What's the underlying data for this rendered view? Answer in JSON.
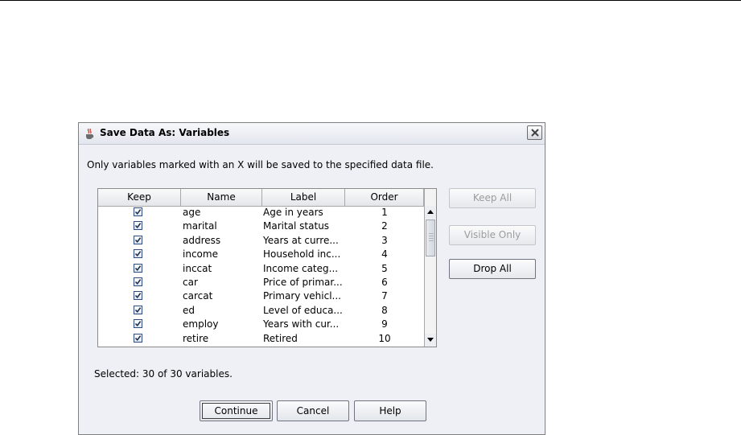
{
  "dialog": {
    "title": "Save Data As: Variables",
    "instruction": "Only variables marked with an X will be saved to the specified data file.",
    "selected_text": "Selected: 30 of 30 variables."
  },
  "table": {
    "columns": [
      "Keep",
      "Name",
      "Label",
      "Order"
    ],
    "rows": [
      {
        "keep": true,
        "name": "age",
        "label": "Age in years",
        "order": "1"
      },
      {
        "keep": true,
        "name": "marital",
        "label": "Marital status",
        "order": "2"
      },
      {
        "keep": true,
        "name": "address",
        "label": "Years at curre...",
        "order": "3"
      },
      {
        "keep": true,
        "name": "income",
        "label": "Household inc...",
        "order": "4"
      },
      {
        "keep": true,
        "name": "inccat",
        "label": "Income categ...",
        "order": "5"
      },
      {
        "keep": true,
        "name": "car",
        "label": "Price of primar...",
        "order": "6"
      },
      {
        "keep": true,
        "name": "carcat",
        "label": "Primary vehicl...",
        "order": "7"
      },
      {
        "keep": true,
        "name": "ed",
        "label": "Level of educa...",
        "order": "8"
      },
      {
        "keep": true,
        "name": "employ",
        "label": "Years with cur...",
        "order": "9"
      },
      {
        "keep": true,
        "name": "retire",
        "label": "Retired",
        "order": "10"
      }
    ]
  },
  "side_buttons": {
    "keep_all": "Keep All",
    "visible_only": "Visible Only",
    "drop_all": "Drop All"
  },
  "bottom_buttons": {
    "continue": "Continue",
    "cancel": "Cancel",
    "help": "Help"
  },
  "icons": {
    "title": "java-cup-icon",
    "close": "close-icon",
    "scroll_up": "scroll-up-arrow-icon",
    "scroll_down": "scroll-down-arrow-icon",
    "checkbox": "checkbox-checked-icon"
  }
}
